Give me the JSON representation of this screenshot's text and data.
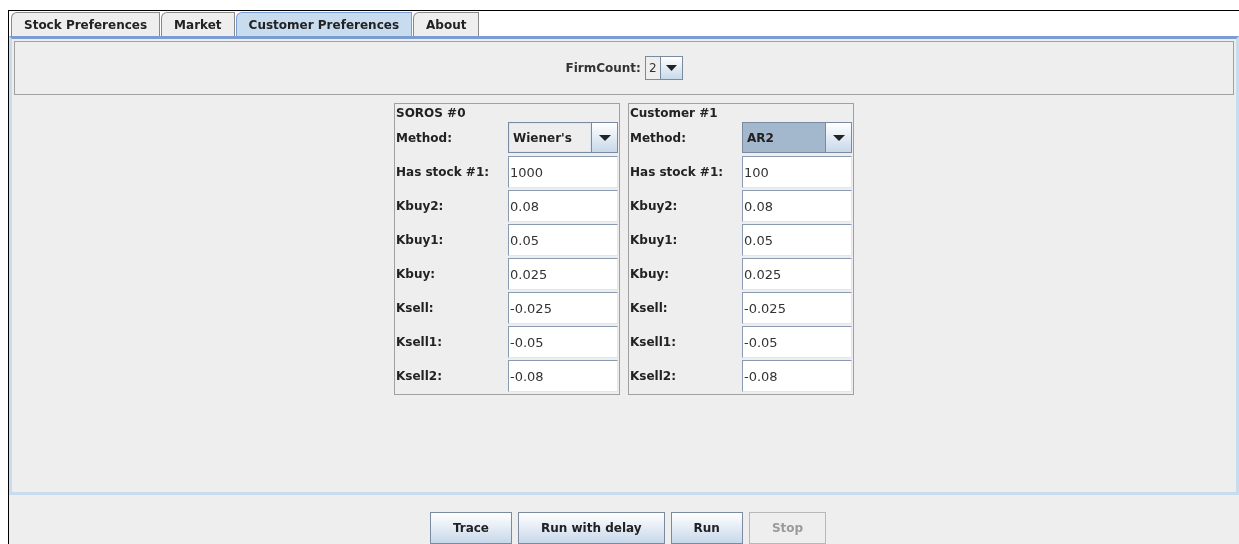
{
  "tabs": [
    {
      "label": "Stock Preferences",
      "selected": false
    },
    {
      "label": "Market",
      "selected": false
    },
    {
      "label": "Customer Preferences",
      "selected": true
    },
    {
      "label": "About",
      "selected": false
    }
  ],
  "firm_count": {
    "label": "FirmCount:",
    "value": "2"
  },
  "customers": [
    {
      "title": "SOROS #0",
      "method_label": "Method:",
      "method": "Wiener's",
      "method_focused": false,
      "fields": [
        {
          "label": "Has stock #1:",
          "value": "1000"
        },
        {
          "label": "Kbuy2:",
          "value": "0.08"
        },
        {
          "label": "Kbuy1:",
          "value": "0.05"
        },
        {
          "label": "Kbuy:",
          "value": "0.025"
        },
        {
          "label": "Ksell:",
          "value": "-0.025"
        },
        {
          "label": "Ksell1:",
          "value": "-0.05"
        },
        {
          "label": "Ksell2:",
          "value": "-0.08"
        }
      ]
    },
    {
      "title": "Customer #1",
      "method_label": "Method:",
      "method": "AR2",
      "method_focused": true,
      "fields": [
        {
          "label": "Has stock #1:",
          "value": "100"
        },
        {
          "label": "Kbuy2:",
          "value": "0.08"
        },
        {
          "label": "Kbuy1:",
          "value": "0.05"
        },
        {
          "label": "Kbuy:",
          "value": "0.025"
        },
        {
          "label": "Ksell:",
          "value": "-0.025"
        },
        {
          "label": "Ksell1:",
          "value": "-0.05"
        },
        {
          "label": "Ksell2:",
          "value": "-0.08"
        }
      ]
    }
  ],
  "buttons": [
    {
      "label": "Trace",
      "disabled": false
    },
    {
      "label": "Run with delay",
      "disabled": false
    },
    {
      "label": "Run",
      "disabled": false
    },
    {
      "label": "Stop",
      "disabled": true
    }
  ]
}
